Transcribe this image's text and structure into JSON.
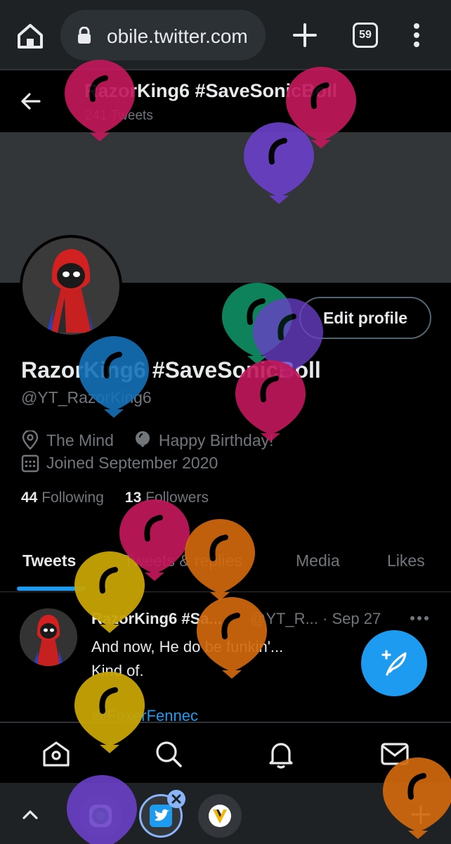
{
  "browser": {
    "url": "obile.twitter.com",
    "tab_count": "59"
  },
  "profile": {
    "header_name": "RazorKing6 #SaveSonicBoll",
    "tweet_count": "241 Tweets",
    "edit_button": "Edit profile",
    "display_name": "RazorKing6 #SaveSonicBoll",
    "handle": "@YT_RazorKing6",
    "location": "The Mind",
    "birthday": "Happy Birthday!",
    "joined": "Joined September 2020",
    "following_count": "44",
    "following_label": "Following",
    "followers_count": "13",
    "followers_label": "Followers"
  },
  "tabs": [
    {
      "label": "Tweets",
      "active": true
    },
    {
      "label": "Tweets & replies",
      "active": false
    },
    {
      "label": "Media",
      "active": false
    },
    {
      "label": "Likes",
      "active": false
    }
  ],
  "tweet": {
    "author": "RazorKing6 #Sa...",
    "meta": "@YT_R... · Sep 27",
    "line1": "And now, He do be funkin'...",
    "line2": "Kind of.",
    "mention": "@FoxerFennec"
  },
  "icons": {
    "home": "home-icon",
    "search": "search-icon",
    "notifications": "bell-icon",
    "messages": "mail-icon",
    "compose": "compose-tweet-icon"
  },
  "colors": {
    "accent": "#1d9bf0",
    "background": "#000000",
    "banner": "#333639",
    "muted_text": "#71767b"
  },
  "balloon_colors": [
    "#c2185b",
    "#6a3fc8",
    "#0f8a5f",
    "#1672b8",
    "#c7a406",
    "#d1690f"
  ]
}
